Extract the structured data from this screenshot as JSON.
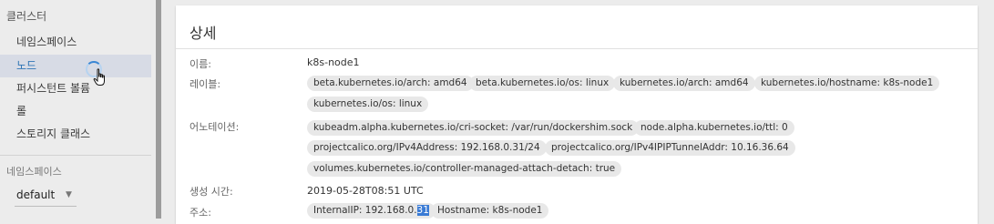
{
  "sidebar": {
    "cluster_title": "클러스터",
    "items": [
      {
        "label": "네임스페이스"
      },
      {
        "label": "노드"
      },
      {
        "label": "퍼시스턴트 볼륨"
      },
      {
        "label": "롤"
      },
      {
        "label": "스토리지 클래스"
      }
    ],
    "namespace_title": "네임스페이스",
    "namespace_selected": "default",
    "namespace_caret": "▼"
  },
  "card": {
    "title": "상세",
    "fields": {
      "name": {
        "label": "이름:",
        "value": "k8s-node1"
      },
      "labels": {
        "label": "레이블:",
        "chips": [
          "beta.kubernetes.io/arch: amd64",
          "beta.kubernetes.io/os: linux",
          "kubernetes.io/arch: amd64",
          "kubernetes.io/hostname: k8s-node1",
          "kubernetes.io/os: linux"
        ]
      },
      "annotations": {
        "label": "어노테이션:",
        "chips": [
          "kubeadm.alpha.kubernetes.io/cri-socket:  /var/run/dockershim.sock",
          "node.alpha.kubernetes.io/ttl:  0",
          "projectcalico.org/IPv4Address:  192.168.0.31/24",
          "projectcalico.org/IPv4IPIPTunnelAddr:  10.16.36.64",
          "volumes.kubernetes.io/controller-managed-attach-detach:  true"
        ]
      },
      "created": {
        "label": "생성 시간:",
        "value": "2019-05-28T08:51 UTC"
      },
      "address": {
        "label": "주소:",
        "internal_ip_prefix": "InternalIP:  192.168.0.",
        "internal_ip_selected": "31",
        "hostname_chip": "Hostname:  k8s-node1"
      }
    }
  },
  "colors": {
    "active_item_bg": "#d7dbe5",
    "active_item_text": "#3277b6",
    "chip_bg": "#e8e8e8",
    "selection": "#3a7bd5"
  }
}
